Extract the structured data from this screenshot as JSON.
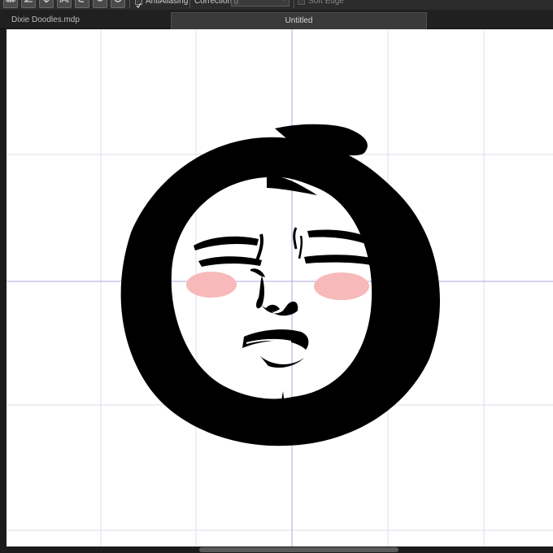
{
  "toolbar": {
    "tool_icons": [
      "grid-icon",
      "ruler-icon",
      "perspective-icon",
      "concentric-icon",
      "curve-icon",
      "rotate-icon",
      "gear-icon"
    ],
    "antialiasing_label": "AntiAliasing",
    "antialiasing_checked": true,
    "correction_label": "Correction",
    "correction_value": "0",
    "soft_edge_label": "Soft Edge",
    "soft_edge_checked": false
  },
  "tabs": {
    "file_name": "Dixie Doodles.mdp",
    "active_tab": "Untitled"
  },
  "canvas": {
    "background": "#ffffff",
    "grid_color": "#dcdcec",
    "guide_color": "#a9a9d9",
    "stroke_color": "#000000",
    "blush_color": "#f7b9b9"
  }
}
